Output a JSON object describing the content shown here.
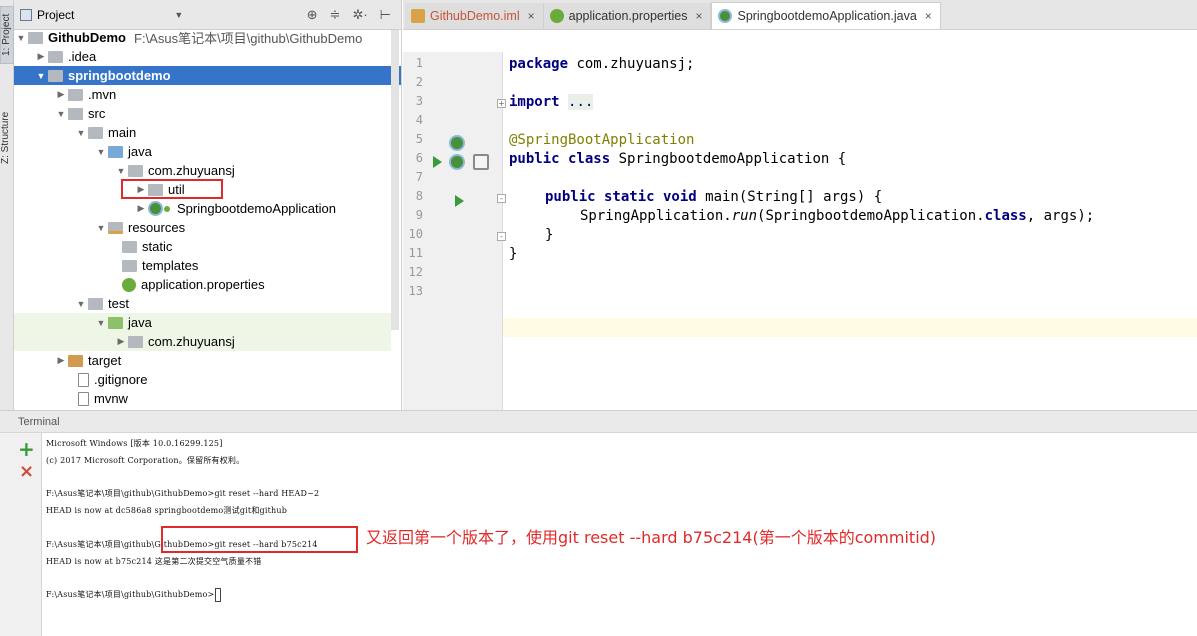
{
  "sidebar_tabs": {
    "project": "1: Project",
    "structure": "Z: Structure"
  },
  "project_panel": {
    "title": "Project",
    "tree": [
      {
        "label": "GithubDemo",
        "path": "F:\\Asus笔记本\\项目\\github\\GithubDemo"
      },
      {
        "label": ".idea"
      },
      {
        "label": "springbootdemo"
      },
      {
        "label": ".mvn"
      },
      {
        "label": "src"
      },
      {
        "label": "main"
      },
      {
        "label": "java"
      },
      {
        "label": "com.zhuyuansj"
      },
      {
        "label": "util"
      },
      {
        "label": "SpringbootdemoApplication"
      },
      {
        "label": "resources"
      },
      {
        "label": "static"
      },
      {
        "label": "templates"
      },
      {
        "label": "application.properties"
      },
      {
        "label": "test"
      },
      {
        "label": "java"
      },
      {
        "label": "com.zhuyuansj"
      },
      {
        "label": "target"
      },
      {
        "label": ".gitignore"
      },
      {
        "label": "mvnw"
      }
    ]
  },
  "editor": {
    "tabs": [
      {
        "label": "GithubDemo.iml",
        "close": "×"
      },
      {
        "label": "application.properties",
        "close": "×"
      },
      {
        "label": "SpringbootdemoApplication.java",
        "close": "×"
      }
    ],
    "line_numbers": [
      "1",
      "2",
      "3",
      "4",
      "5",
      "6",
      "7",
      "8",
      "9",
      "10",
      "11",
      "12",
      "13"
    ],
    "code": {
      "l1_kw": "package",
      "l1_rest": " com.zhuyuansj;",
      "l3_kw": "import",
      "l3_dots": "...",
      "l6": "@SpringBootApplication",
      "l7_kw": "public class",
      "l7_rest": " SpringbootdemoApplication {",
      "l9_kw": "public static void",
      "l9_rest": " main(String[] args) {",
      "l10_a": "SpringApplication.",
      "l10_run": "run",
      "l10_b": "(SpringbootdemoApplication.",
      "l10_cls": "class",
      "l10_c": ", args);",
      "l11": "}",
      "l12": "}"
    }
  },
  "terminal": {
    "title": "Terminal",
    "add_label": "+",
    "close_label": "×",
    "lines": [
      "Microsoft Windows [版本 10.0.16299.125]",
      "(c) 2017 Microsoft Corporation。保留所有权利。",
      "F:\\Asus笔记本\\项目\\github\\GithubDemo>git reset --hard HEAD~2",
      "HEAD is now at dc586a8 springbootdemo测试git和github",
      "F:\\Asus笔记本\\项目\\github\\GithubDemo>git reset --hard b75c214",
      "HEAD is now at b75c214 这是第二次提交空气质量不错",
      "F:\\Asus笔记本\\项目\\github\\GithubDemo>"
    ]
  },
  "annotation": {
    "prefix": "又返回第一个版本了，使用",
    "command": "git reset --hard b75c214",
    "suffix": "(第一个版本的commitid)"
  },
  "colors": {
    "selection": "#3574c8",
    "highlight_box": "#e02a2a",
    "keyword": "#000080",
    "annotation": "#808000"
  }
}
